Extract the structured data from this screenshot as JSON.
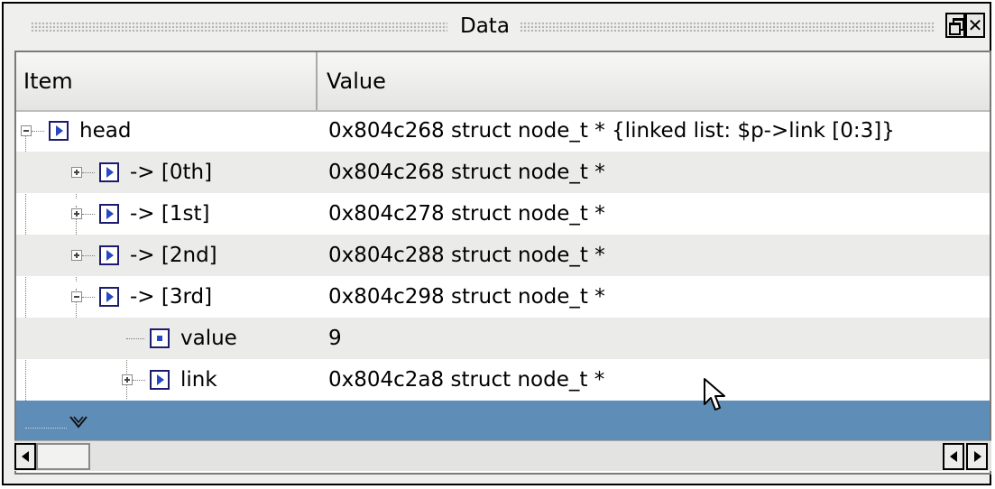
{
  "window": {
    "title": "Data"
  },
  "columns": {
    "item": "Item",
    "value": "Value"
  },
  "rows": [
    {
      "label": "head",
      "value": "0x804c268 struct node_t * {linked list: $p->link [0:3]}",
      "icon": "pointer-icon",
      "expander": "expanded"
    },
    {
      "label": "-> [0th]",
      "value": "0x804c268 struct node_t *",
      "icon": "pointer-icon",
      "expander": "collapsed"
    },
    {
      "label": "-> [1st]",
      "value": "0x804c278 struct node_t *",
      "icon": "pointer-icon",
      "expander": "collapsed"
    },
    {
      "label": "-> [2nd]",
      "value": "0x804c288 struct node_t *",
      "icon": "pointer-icon",
      "expander": "collapsed"
    },
    {
      "label": "-> [3rd]",
      "value": "0x804c298 struct node_t *",
      "icon": "pointer-icon",
      "expander": "expanded"
    },
    {
      "label": "value",
      "value": "9",
      "icon": "value-icon",
      "expander": "none"
    },
    {
      "label": "link",
      "value": "0x804c2a8 struct node_t *",
      "icon": "pointer-icon",
      "expander": "collapsed"
    }
  ],
  "more_row": {
    "icon": "more-chevron-icon"
  },
  "colors": {
    "selection": "#5e8db8",
    "alt_row": "#ebebea",
    "icon_accent": "#2747c4"
  }
}
